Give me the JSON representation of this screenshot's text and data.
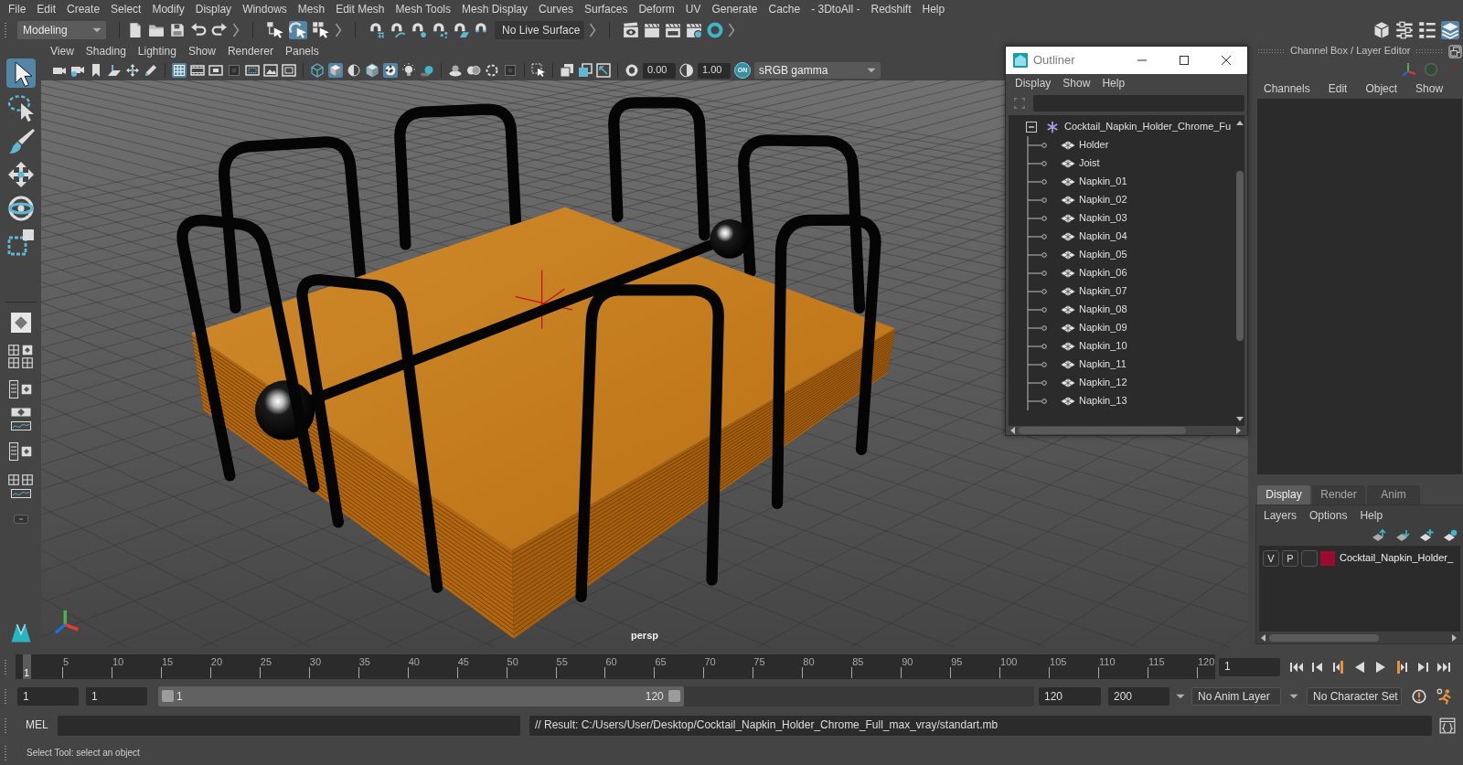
{
  "menu_bar": [
    "File",
    "Edit",
    "Create",
    "Select",
    "Modify",
    "Display",
    "Windows",
    "Mesh",
    "Edit Mesh",
    "Mesh Tools",
    "Mesh Display",
    "Curves",
    "Surfaces",
    "Deform",
    "UV",
    "Generate",
    "Cache",
    "- 3DtoAll -",
    "Redshift",
    "Help"
  ],
  "status_line": {
    "menu_set": "Modeling",
    "select_mode_buttons": [
      {
        "on": false
      },
      {
        "on": true
      },
      {
        "on": false
      }
    ],
    "live_surface": "No Live Surface",
    "workspace_buttons": [
      {
        "on": false
      },
      {
        "on": false
      },
      {
        "on": false
      },
      {
        "on": true
      }
    ]
  },
  "tool_box": {
    "tools": [
      {
        "selected": true
      },
      {
        "selected": false
      },
      {
        "selected": false
      },
      {
        "selected": false
      },
      {
        "selected": false
      },
      {
        "selected": false
      }
    ]
  },
  "viewport_panel": {
    "menu": [
      "View",
      "Shading",
      "Lighting",
      "Show",
      "Renderer",
      "Panels"
    ],
    "toolbar_buttons": [
      {
        "on": false
      },
      {
        "on": false
      },
      {
        "on": false
      },
      {
        "on": false
      },
      {
        "on": false
      },
      {
        "on": false
      },
      {
        "on": true
      },
      {
        "on": false
      },
      {
        "on": false
      },
      {
        "on": false
      },
      {
        "on": false
      },
      {
        "on": false
      },
      {
        "on": false
      },
      {
        "on": false
      },
      {
        "on": true
      },
      {
        "on": false
      },
      {
        "on": false
      },
      {
        "on": true
      },
      {
        "on": false
      },
      {
        "on": false
      },
      {
        "on": false
      },
      {
        "on": false
      },
      {
        "on": false
      },
      {
        "on": false
      },
      {
        "on": false
      },
      {
        "on": false
      },
      {
        "on": false
      },
      {
        "on": false
      },
      {
        "on": false
      },
      {
        "on": false
      }
    ],
    "exposure": "0.00",
    "gamma": "1.00",
    "color_management": "ON",
    "view_transform": "sRGB gamma",
    "camera_label": "persp"
  },
  "outliner": {
    "title": "Outliner",
    "menu": [
      "Display",
      "Show",
      "Help"
    ],
    "tree": [
      {
        "label": "Cocktail_Napkin_Holder_Chrome_Fu",
        "expanded": true,
        "selected": false,
        "children": [
          {
            "label": "Holder",
            "selected": false
          },
          {
            "label": "Joist",
            "selected": false
          },
          {
            "label": "Napkin_01",
            "selected": false
          },
          {
            "label": "Napkin_02",
            "selected": false
          },
          {
            "label": "Napkin_03",
            "selected": false
          },
          {
            "label": "Napkin_04",
            "selected": false
          },
          {
            "label": "Napkin_05",
            "selected": false
          },
          {
            "label": "Napkin_06",
            "selected": false
          },
          {
            "label": "Napkin_07",
            "selected": false
          },
          {
            "label": "Napkin_08",
            "selected": false
          },
          {
            "label": "Napkin_09",
            "selected": false
          },
          {
            "label": "Napkin_10",
            "selected": false
          },
          {
            "label": "Napkin_11",
            "selected": false
          },
          {
            "label": "Napkin_12",
            "selected": false
          },
          {
            "label": "Napkin_13",
            "selected": false
          }
        ]
      }
    ]
  },
  "channel_box": {
    "title": "Channel Box / Layer Editor",
    "menu": [
      "Channels",
      "Edit",
      "Object",
      "Show"
    ]
  },
  "layer_editor": {
    "tabs": [
      {
        "label": "Display",
        "selected": true
      },
      {
        "label": "Render",
        "selected": false
      },
      {
        "label": "Anim",
        "selected": false
      }
    ],
    "menu": [
      "Layers",
      "Options",
      "Help"
    ],
    "layers": [
      {
        "visible_toggle": "V",
        "playback_toggle": "P",
        "color": "#9b0b2c",
        "name": "Cocktail_Napkin_Holder_",
        "selected": false
      }
    ]
  },
  "time_slider": {
    "current_frame_marker": "1",
    "level": 0,
    "tick_labels": [
      "5",
      "10",
      "15",
      "20",
      "25",
      "30",
      "35",
      "40",
      "45",
      "50",
      "55",
      "60",
      "65",
      "70",
      "75",
      "80",
      "85",
      "90",
      "95",
      "100",
      "105",
      "110",
      "115",
      "120"
    ],
    "current_frame": "1"
  },
  "range_slider": {
    "animation_start": "1",
    "playback_start": "1",
    "range_start": "1",
    "range_end": "120",
    "level": 0.6,
    "playback_end": "120",
    "animation_end": "200",
    "anim_layer": "No Anim Layer",
    "character_set": "No Character Set"
  },
  "command_line": {
    "language": "MEL",
    "result": "// Result: C:/Users/User/Desktop/Cocktail_Napkin_Holder_Chrome_Full_max_vray/standart.mb"
  },
  "help_line": "Select Tool: select an object"
}
